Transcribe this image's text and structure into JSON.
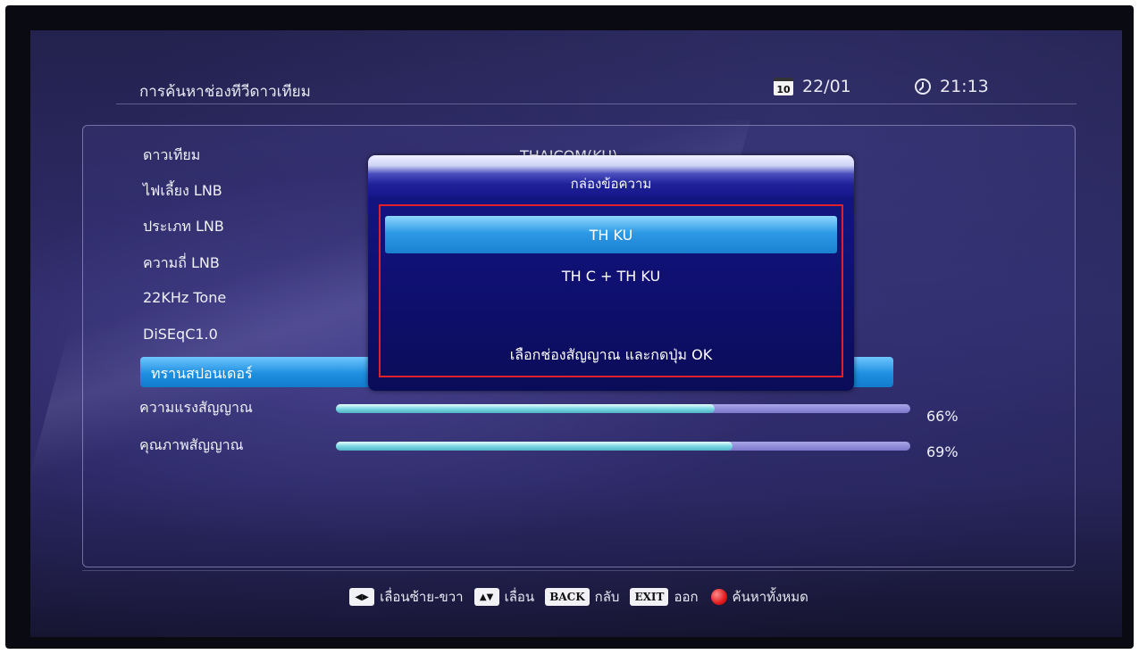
{
  "header": {
    "title": "การค้นหาช่องทีวีดาวเทียม",
    "calendar_icon_text": "10",
    "date": "22/01",
    "time": "21:13"
  },
  "settings": {
    "rows": [
      {
        "label": "ดาวเทียม"
      },
      {
        "label": "ไฟเลี้ยง LNB"
      },
      {
        "label": "ประเภท LNB"
      },
      {
        "label": "ความถี่ LNB"
      },
      {
        "label": "22KHz Tone"
      },
      {
        "label": "DiSEqC1.0"
      },
      {
        "label": "ทรานสปอนเดอร์"
      }
    ],
    "satellite_value": "THAICOM(KU)"
  },
  "signal": {
    "strength_label": "ความแรงสัญญาณ",
    "strength_value": 0.66,
    "strength_text": "66%",
    "quality_label": "คุณภาพสัญญาณ",
    "quality_value": 0.69,
    "quality_text": "69%"
  },
  "dialog": {
    "title": "กล่องข้อความ",
    "options": [
      "TH KU",
      "TH C + TH KU"
    ],
    "selected_index": 0,
    "hint": "เลือกช่องสัญญาณ และกดปุ่ม OK"
  },
  "footer": {
    "left_right_key": "◀▶",
    "left_right_label": "เลื่อนซ้าย-ขวา",
    "up_down_key": "▲▼",
    "up_down_label": "เลื่อน",
    "back_key": "BACK",
    "back_label": "กลับ",
    "exit_key": "EXIT",
    "exit_label": "ออก",
    "search_all_label": "ค้นหาทั้งหมด"
  },
  "colors": {
    "highlight": "#1e8fe0",
    "dialog_bg": "#0e0f6e",
    "frame_red": "#e0202a",
    "bar_fill": "#7fd8e4"
  }
}
